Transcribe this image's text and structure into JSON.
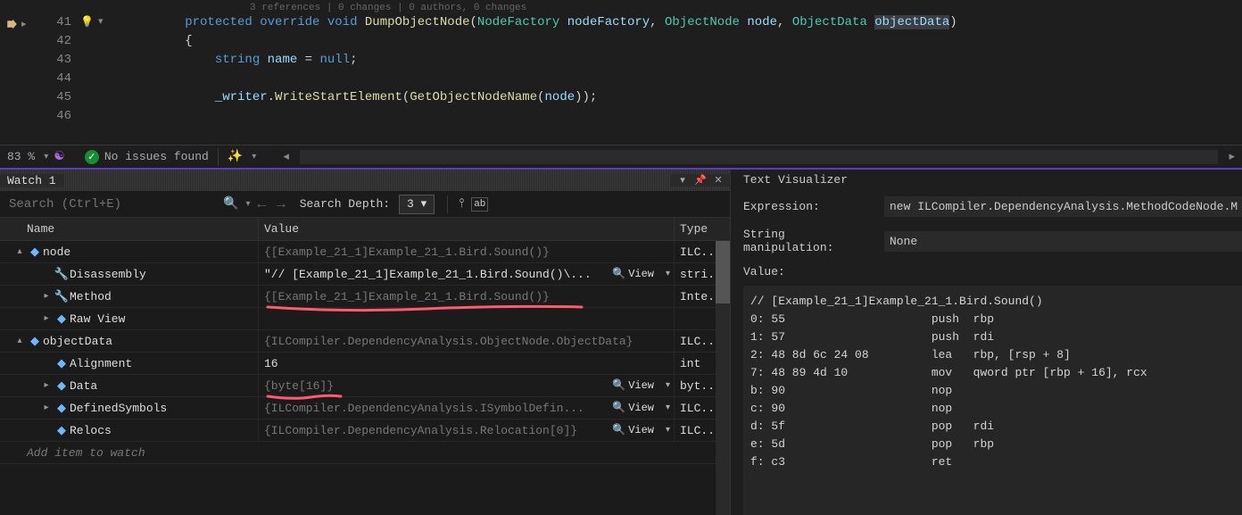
{
  "codelens": "3 references | 0 changes | 0 authors, 0 changes",
  "code": {
    "lines": [
      {
        "n": "41",
        "bulb": "💡",
        "fold": "▾"
      },
      {
        "n": "42"
      },
      {
        "n": "43"
      },
      {
        "n": "44"
      },
      {
        "n": "45"
      },
      {
        "n": "46"
      }
    ],
    "sig": {
      "protected": "protected",
      "override": "override",
      "void": "void",
      "method": "DumpObjectNode",
      "p1t": "NodeFactory",
      "p1n": "nodeFactory",
      "p2t": "ObjectNode",
      "p2n": "node",
      "p3t": "ObjectData",
      "p3n": "objectData"
    },
    "l43_kw": "string",
    "l43_name": "name",
    "l43_null": "null",
    "l45_field": "_writer",
    "l45_m1": "WriteStartElement",
    "l45_m2": "GetObjectNodeName",
    "l45_arg": "node"
  },
  "status": {
    "zoom": "83 %",
    "issues": "No issues found"
  },
  "watch": {
    "title": "Watch 1",
    "search_placeholder": "Search (Ctrl+E)",
    "depth_label": "Search Depth:",
    "depth_value": "3",
    "cols": {
      "name": "Name",
      "value": "Value",
      "type": "Type"
    },
    "rows": [
      {
        "exp": "▴",
        "ind": 0,
        "icon": "cube",
        "name": "node",
        "value": "{[Example_21_1]Example_21_1.Bird.Sound()}",
        "type": "ILC...",
        "ro": true
      },
      {
        "exp": "",
        "ind": 1,
        "icon": "wrench",
        "name": "Disassembly",
        "value": "\"// [Example_21_1]Example_21_1.Bird.Sound()\\...",
        "type": "stri...",
        "view": true,
        "ro": false
      },
      {
        "exp": "▸",
        "ind": 1,
        "icon": "wrench",
        "name": "Method",
        "value": "{[Example_21_1]Example_21_1.Bird.Sound()}",
        "type": "Inte...",
        "ro": true
      },
      {
        "exp": "▸",
        "ind": 1,
        "icon": "cube",
        "name": "Raw View",
        "value": "",
        "type": "",
        "ro": true
      },
      {
        "exp": "▴",
        "ind": 0,
        "icon": "cube",
        "name": "objectData",
        "value": "{ILCompiler.DependencyAnalysis.ObjectNode.ObjectData}",
        "type": "ILC...",
        "ro": true
      },
      {
        "exp": "",
        "ind": 1,
        "icon": "cube",
        "name": "Alignment",
        "value": "16",
        "type": "int",
        "ro": false
      },
      {
        "exp": "▸",
        "ind": 1,
        "icon": "cube",
        "name": "Data",
        "value": "{byte[16]}",
        "type": "byt...",
        "view": true,
        "ro": true
      },
      {
        "exp": "▸",
        "ind": 1,
        "icon": "cube",
        "name": "DefinedSymbols",
        "value": "{ILCompiler.DependencyAnalysis.ISymbolDefin...",
        "type": "ILC...",
        "view": true,
        "ro": true
      },
      {
        "exp": "",
        "ind": 1,
        "icon": "cube",
        "name": "Relocs",
        "value": "{ILCompiler.DependencyAnalysis.Relocation[0]}",
        "type": "ILC...",
        "view": true,
        "ro": true
      }
    ],
    "view_label": "View",
    "add": "Add item to watch"
  },
  "viz": {
    "title": "Text Visualizer",
    "expr_label": "Expression:",
    "expr_value": "new ILCompiler.DependencyAnalysis.MethodCodeNode.M",
    "manip_label": "String manipulation:",
    "manip_value": "None",
    "value_label": "Value:",
    "asm": [
      "// [Example_21_1]Example_21_1.Bird.Sound()",
      "0: 55                     push  rbp",
      "1: 57                     push  rdi",
      "2: 48 8d 6c 24 08         lea   rbp, [rsp + 8]",
      "7: 48 89 4d 10            mov   qword ptr [rbp + 16], rcx",
      "b: 90                     nop",
      "c: 90                     nop",
      "d: 5f                     pop   rdi",
      "e: 5d                     pop   rbp",
      "f: c3                     ret"
    ]
  }
}
